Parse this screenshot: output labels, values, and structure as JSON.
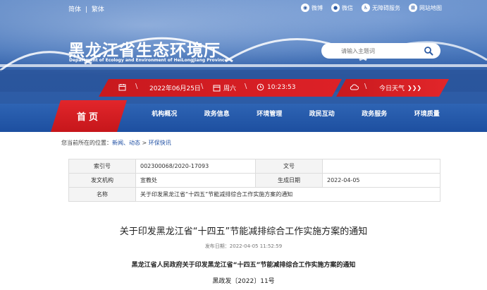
{
  "header": {
    "lang": [
      "简体",
      "|",
      "繁体"
    ],
    "toplinks": [
      {
        "icon": "weibo-icon",
        "label": "微博"
      },
      {
        "icon": "wechat-icon",
        "label": "微信"
      },
      {
        "icon": "accessibility-icon",
        "label": "无障碍服务"
      },
      {
        "icon": "sitemap-icon",
        "label": "网站地图"
      }
    ],
    "title": "黑龙江省生态环境厅",
    "subtitle": "Department of Ecology and Environment of HeiLongJiang Province",
    "search_placeholder": "请输入主题词"
  },
  "datebar": {
    "date": "2022年06月25日",
    "weekday": "周六",
    "time": "10:23:53",
    "weather": "今日天气",
    "weather_arrow": "❯❯❯",
    "separator": "\\"
  },
  "nav": {
    "home": "首页",
    "items": [
      "机构概况",
      "政务信息",
      "环境管理",
      "政民互动",
      "政务服务",
      "环境质量"
    ]
  },
  "breadcrumb": {
    "prefix": "您当前所在的位置：",
    "items": [
      "新闻、动态",
      "环保快讯"
    ],
    "separator": " > "
  },
  "meta": {
    "rows": [
      {
        "k1": "索引号",
        "v1": "002300068/2020-17093",
        "k2": "文号",
        "v2": ""
      },
      {
        "k1": "发文机构",
        "v1": "宣教处",
        "k2": "生成日期",
        "v2": "2022-04-05"
      }
    ],
    "name_label": "名称",
    "name_value": "关于印发黑龙江省“十四五”节能减排综合工作实施方案的通知"
  },
  "article": {
    "title": "关于印发黑龙江省“十四五”节能减排综合工作实施方案的通知",
    "pubdate": "发布日期：2022-04-05 11:52:59",
    "headline": "黑龙江省人民政府关于印发黑龙江省“十四五”节能减排综合工作实施方案的通知",
    "docno": "黑政发〔2022〕11号"
  },
  "colors": {
    "brand_red": "#d21c22",
    "nav_blue": "#2a5aa8",
    "link_blue": "#1f4fa3"
  }
}
